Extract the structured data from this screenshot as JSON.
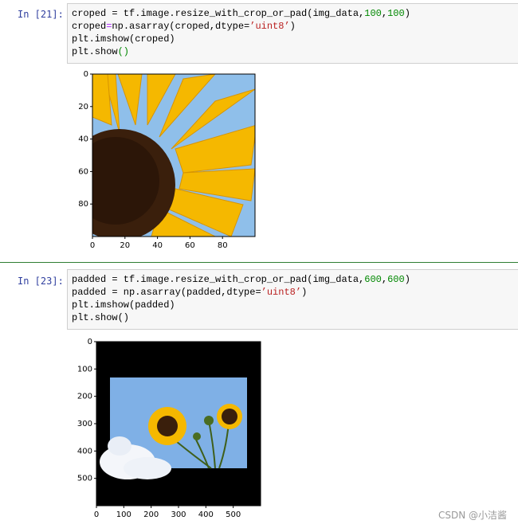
{
  "cells": [
    {
      "prompt": "In  [21]:",
      "code": [
        {
          "parts": [
            [
              "croped = tf.image.resize_with_crop_or_pad(img_data,",
              ""
            ],
            [
              "100",
              "num"
            ],
            [
              ",",
              ""
            ],
            [
              "100",
              "num"
            ],
            [
              ")",
              ""
            ]
          ]
        },
        {
          "parts": [
            [
              "croped",
              ""
            ],
            [
              "=",
              "op"
            ],
            [
              "np.asarray(croped,dtype=",
              ""
            ],
            [
              "’uint8’",
              "str"
            ],
            [
              ")",
              ""
            ]
          ]
        },
        {
          "parts": [
            [
              "plt.imshow(croped)",
              ""
            ]
          ]
        },
        {
          "parts": [
            [
              "plt.show",
              ""
            ],
            [
              "()",
              "num"
            ]
          ]
        }
      ],
      "output": {
        "x_ticks": [
          "0",
          "20",
          "40",
          "60",
          "80"
        ],
        "y_ticks": [
          "0",
          "20",
          "40",
          "60",
          "80"
        ]
      }
    },
    {
      "prompt": "In  [23]:",
      "code": [
        {
          "parts": [
            [
              "padded = tf.image.resize_with_crop_or_pad(img_data,",
              ""
            ],
            [
              "600",
              "num"
            ],
            [
              ",",
              ""
            ],
            [
              "600",
              "num"
            ],
            [
              ")",
              ""
            ]
          ]
        },
        {
          "parts": [
            [
              "padded = np.asarray(padded,dtype=",
              ""
            ],
            [
              "’uint8’",
              "str"
            ],
            [
              ")",
              ""
            ]
          ]
        },
        {
          "parts": [
            [
              "plt.imshow(padded)",
              ""
            ]
          ]
        },
        {
          "parts": [
            [
              "plt.show()",
              ""
            ]
          ]
        }
      ],
      "output": {
        "x_ticks": [
          "0",
          "100",
          "200",
          "300",
          "400",
          "500"
        ],
        "y_ticks": [
          "0",
          "100",
          "200",
          "300",
          "400",
          "500"
        ]
      }
    }
  ],
  "colors": {
    "divider": "#2e7d32",
    "prompt": "#303f9f",
    "cell_bg": "#f7f7f7",
    "sky": "#7fb0e6",
    "petal": "#f5b800",
    "center": "#3a1f0c"
  },
  "watermark": "CSDN @小洁酱"
}
